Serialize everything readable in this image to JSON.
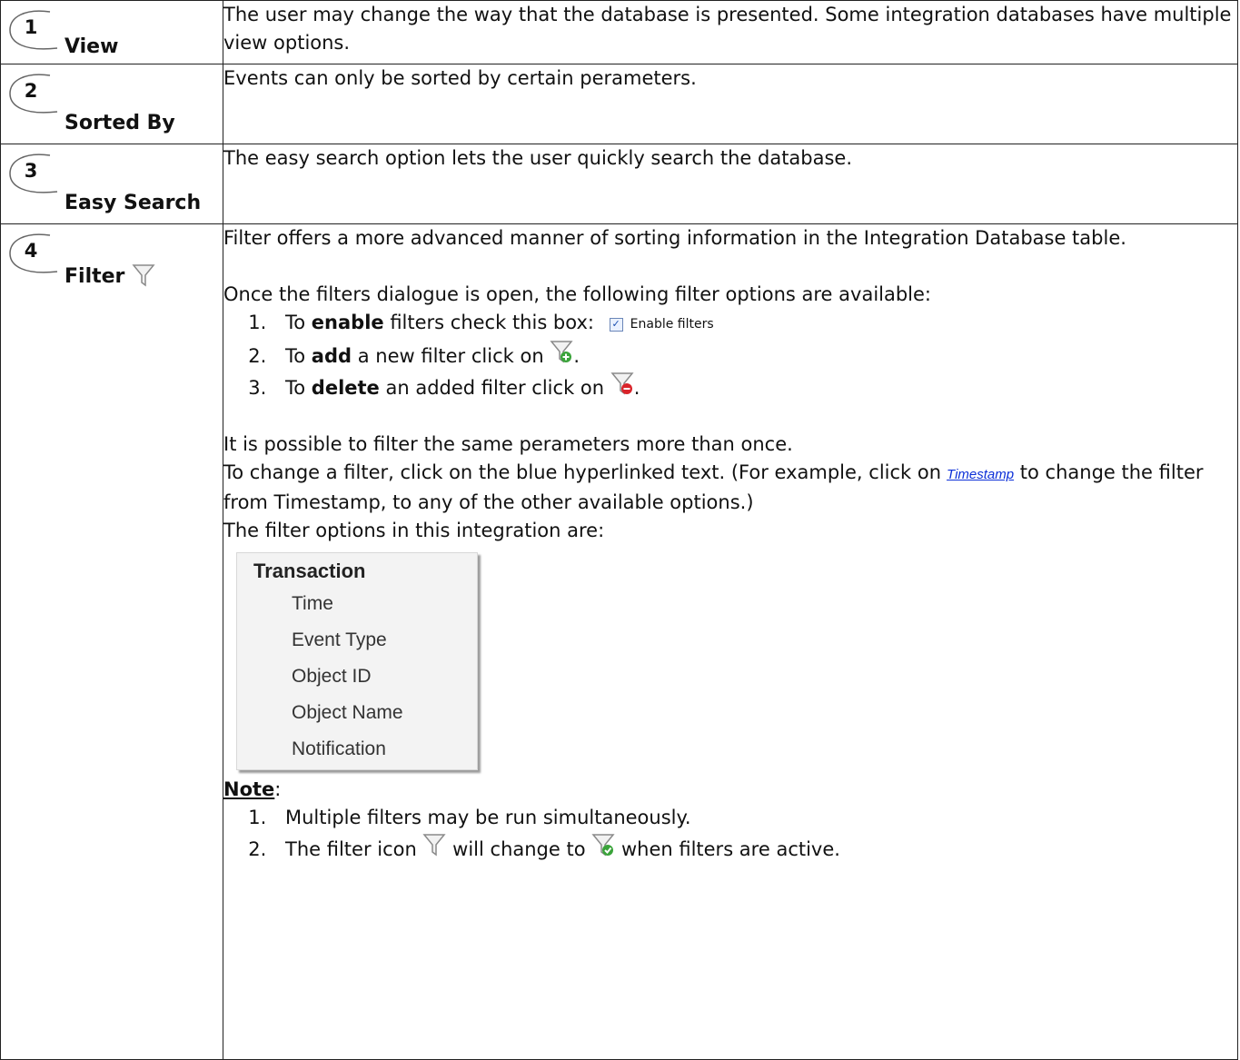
{
  "rows": [
    {
      "num": "1",
      "label": "View",
      "text": "The user may change the way that the database is presented. Some integration databases have multiple view options."
    },
    {
      "num": "2",
      "label": "Sorted By",
      "text": "Events can only be sorted by certain perameters."
    },
    {
      "num": "3",
      "label": "Easy Search",
      "text": "The easy search option lets the user quickly search the database."
    },
    {
      "num": "4",
      "label": "Filter"
    }
  ],
  "filter": {
    "intro": "Filter offers a more advanced manner of sorting information in the Integration Database table.",
    "open_line": "Once the filters dialogue is open, the following filter options are available:",
    "steps": [
      {
        "pre": "To ",
        "bold": "enable",
        "post": " filters check this box:"
      },
      {
        "pre": "To ",
        "bold": "add",
        "post": " a new filter click on"
      },
      {
        "pre": "To ",
        "bold": "delete",
        "post": " an added filter click on"
      }
    ],
    "enable_checkbox_label": "Enable filters",
    "same_param": "It is possible to filter the same perameters  more than once.",
    "change_pre": "To change a filter, click on the blue hyperlinked text. (For example, click on",
    "timestamp_link": "Timestamp",
    "change_post": "to change the filter from Timestamp, to any of the other available options.)",
    "options_intro": "The filter options in this integration are:",
    "options_header": "Transaction",
    "options": [
      "Time",
      "Event Type",
      "Object ID",
      "Object Name",
      "Notification"
    ],
    "note_label": "Note",
    "notes": [
      "Multiple filters may be run simultaneously."
    ],
    "note2_pre": "The filter icon",
    "note2_mid": "will change to",
    "note2_post": "when filters are active."
  },
  "colors": {
    "border": "#222222",
    "link": "#0b2fd8",
    "add_badge": "#3aa33a",
    "delete_badge": "#d9242b",
    "active_badge": "#3aa33a"
  }
}
